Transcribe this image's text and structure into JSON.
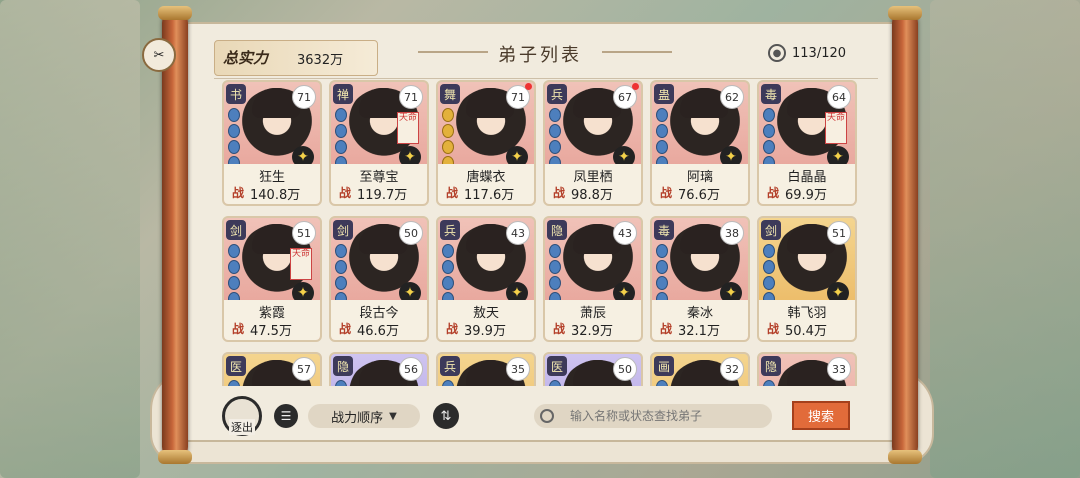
{
  "header": {
    "power_label": "总实力",
    "power_value": "3632万",
    "title": "弟子列表",
    "count": "113/120"
  },
  "cards": [
    {
      "cls": "书",
      "level": "71",
      "name": "狂生",
      "power": "140.8万",
      "rarity": "red",
      "seal": "",
      "dot": false,
      "gem": "blue"
    },
    {
      "cls": "禅",
      "level": "71",
      "name": "至尊宝",
      "power": "119.7万",
      "rarity": "red",
      "seal": "天命",
      "dot": false,
      "gem": "blue"
    },
    {
      "cls": "舞",
      "level": "71",
      "name": "唐蝶衣",
      "power": "117.6万",
      "rarity": "red",
      "seal": "",
      "dot": true,
      "gem": "gold"
    },
    {
      "cls": "兵",
      "level": "67",
      "name": "凤里栖",
      "power": "98.8万",
      "rarity": "red",
      "seal": "",
      "dot": true,
      "gem": "blue"
    },
    {
      "cls": "蛊",
      "level": "62",
      "name": "阿璃",
      "power": "76.6万",
      "rarity": "red",
      "seal": "",
      "dot": false,
      "gem": "blue"
    },
    {
      "cls": "毒",
      "level": "64",
      "name": "白晶晶",
      "power": "69.9万",
      "rarity": "red",
      "seal": "天命",
      "dot": false,
      "gem": "blue"
    },
    {
      "cls": "剑",
      "level": "51",
      "name": "紫霞",
      "power": "47.5万",
      "rarity": "red",
      "seal": "天命",
      "dot": false,
      "gem": "blue"
    },
    {
      "cls": "剑",
      "level": "50",
      "name": "段古今",
      "power": "46.6万",
      "rarity": "red",
      "seal": "",
      "dot": false,
      "gem": "blue"
    },
    {
      "cls": "兵",
      "level": "43",
      "name": "敖天",
      "power": "39.9万",
      "rarity": "red",
      "seal": "",
      "dot": false,
      "gem": "blue"
    },
    {
      "cls": "隐",
      "level": "43",
      "name": "萧辰",
      "power": "32.9万",
      "rarity": "red",
      "seal": "",
      "dot": false,
      "gem": "blue"
    },
    {
      "cls": "毒",
      "level": "38",
      "name": "秦冰",
      "power": "32.1万",
      "rarity": "red",
      "seal": "",
      "dot": false,
      "gem": "blue"
    },
    {
      "cls": "剑",
      "level": "51",
      "name": "韩飞羽",
      "power": "50.4万",
      "rarity": "gold",
      "seal": "",
      "dot": false,
      "gem": "blue"
    },
    {
      "cls": "医",
      "level": "57",
      "name": "",
      "power": "",
      "rarity": "gold",
      "seal": "",
      "dot": false,
      "gem": "blue"
    },
    {
      "cls": "隐",
      "level": "56",
      "name": "",
      "power": "",
      "rarity": "purple",
      "seal": "",
      "dot": false,
      "gem": "blue"
    },
    {
      "cls": "兵",
      "level": "35",
      "name": "",
      "power": "",
      "rarity": "gold",
      "seal": "",
      "dot": false,
      "gem": "blue"
    },
    {
      "cls": "医",
      "level": "50",
      "name": "",
      "power": "",
      "rarity": "purple",
      "seal": "",
      "dot": false,
      "gem": "blue"
    },
    {
      "cls": "画",
      "level": "32",
      "name": "",
      "power": "",
      "rarity": "gold",
      "seal": "",
      "dot": false,
      "gem": "blue"
    },
    {
      "cls": "隐",
      "level": "33",
      "name": "",
      "power": "",
      "rarity": "red",
      "seal": "",
      "dot": false,
      "gem": "blue"
    }
  ],
  "card_power_prefix": "战",
  "bottom": {
    "exit_label": "逐出",
    "sort_label": "战力顺序",
    "search_placeholder": "输入名称或状态查找弟子",
    "search_button": "搜索"
  },
  "side_emblem": "✂"
}
